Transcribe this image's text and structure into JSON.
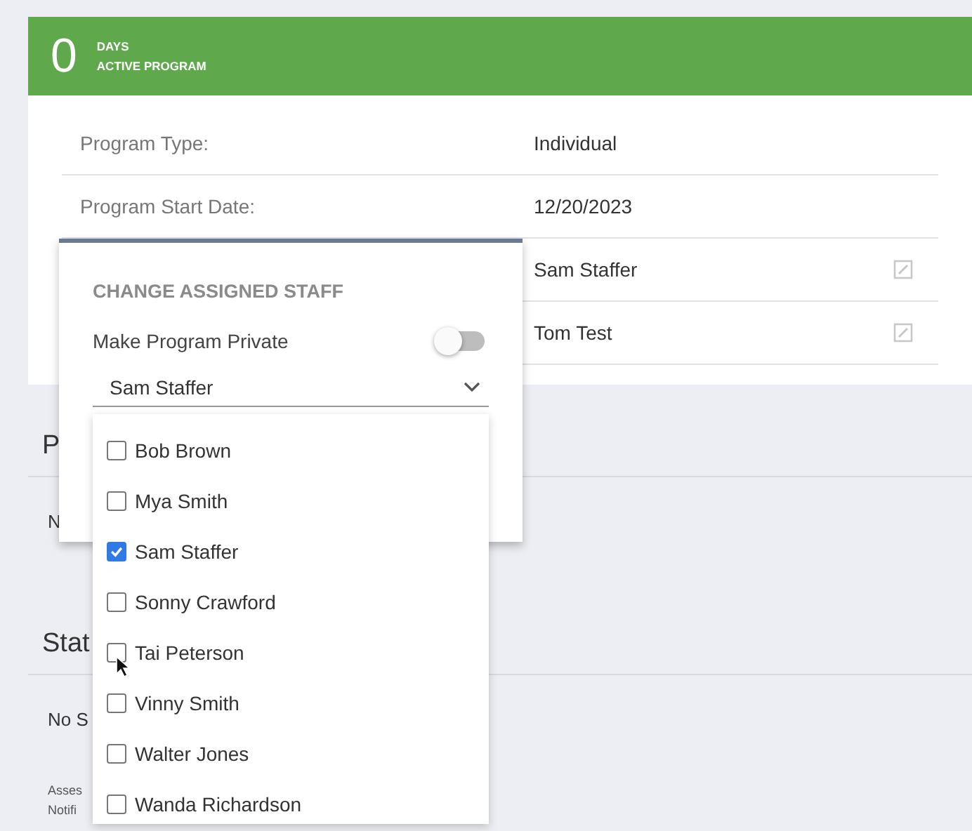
{
  "banner": {
    "count": "0",
    "unit": "DAYS",
    "caption": "ACTIVE PROGRAM"
  },
  "details": [
    {
      "label": "Program Type:",
      "value": "Individual",
      "editable": false
    },
    {
      "label": "Program Start Date:",
      "value": "12/20/2023",
      "editable": false
    },
    {
      "value": "Sam Staffer",
      "editable": true
    },
    {
      "value": "Tom Test",
      "editable": true
    }
  ],
  "sections": [
    {
      "heading": "P",
      "lines": [
        {
          "text": "N",
          "kind": "body"
        }
      ]
    },
    {
      "heading": "Stat",
      "lines": [
        {
          "text": "No S",
          "kind": "body"
        },
        {
          "text": "Asses",
          "kind": "small"
        },
        {
          "text": "Notifi",
          "kind": "small"
        }
      ]
    }
  ],
  "popup": {
    "title": "CHANGE ASSIGNED STAFF",
    "private_label": "Make Program Private",
    "private_on": false,
    "select_value": "Sam Staffer",
    "options": [
      {
        "name": "Bob Brown",
        "checked": false
      },
      {
        "name": "Mya Smith",
        "checked": false
      },
      {
        "name": "Sam Staffer",
        "checked": true
      },
      {
        "name": "Sonny Crawford",
        "checked": false
      },
      {
        "name": "Tai Peterson",
        "checked": false,
        "hovered": true
      },
      {
        "name": "Vinny Smith",
        "checked": false
      },
      {
        "name": "Walter Jones",
        "checked": false
      },
      {
        "name": "Wanda Richardson",
        "checked": false
      }
    ]
  }
}
